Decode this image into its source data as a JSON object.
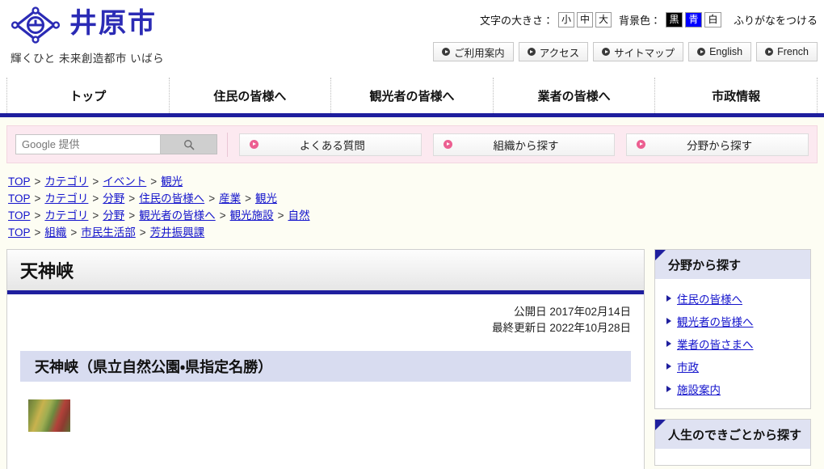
{
  "header": {
    "city_name": "井原市",
    "tagline": "輝くひと 未来創造都市 いばら",
    "emblem_icon": "city-emblem-icon",
    "text_size": {
      "label": "文字の大きさ：",
      "options": [
        "小",
        "中",
        "大"
      ]
    },
    "background_color": {
      "label": "背景色：",
      "options": [
        "黒",
        "青",
        "白"
      ]
    },
    "furigana_label": "ふりがなをつける",
    "links": [
      {
        "label": "ご利用案内",
        "icon": "play-circle-icon"
      },
      {
        "label": "アクセス",
        "icon": "play-circle-icon"
      },
      {
        "label": "サイトマップ",
        "icon": "play-circle-icon"
      },
      {
        "label": "English",
        "icon": "play-circle-icon"
      },
      {
        "label": "French",
        "icon": "play-circle-icon"
      }
    ]
  },
  "global_nav": {
    "items": [
      {
        "label": "トップ"
      },
      {
        "label": "住民の皆様へ"
      },
      {
        "label": "観光者の皆様へ"
      },
      {
        "label": "業者の皆様へ"
      },
      {
        "label": "市政情報"
      }
    ]
  },
  "quickbar": {
    "search": {
      "placeholder": "Google 提供",
      "value": "",
      "button_icon": "magnifier-icon"
    },
    "links": [
      {
        "label": "よくある質問",
        "icon": "pink-play-icon"
      },
      {
        "label": "組織から探す",
        "icon": "pink-play-icon"
      },
      {
        "label": "分野から探す",
        "icon": "pink-play-icon"
      }
    ]
  },
  "breadcrumbs": [
    {
      "items": [
        "TOP",
        "カテゴリ",
        "イベント",
        "観光"
      ]
    },
    {
      "items": [
        "TOP",
        "カテゴリ",
        "分野",
        "住民の皆様へ",
        "産業",
        "観光"
      ]
    },
    {
      "items": [
        "TOP",
        "カテゴリ",
        "分野",
        "観光者の皆様へ",
        "観光施設",
        "自然"
      ]
    },
    {
      "items": [
        "TOP",
        "組織",
        "市民生活部",
        "芳井振興課"
      ]
    }
  ],
  "article": {
    "title": "天神峡",
    "published_label": "公開日 2017年02月14日",
    "updated_label": "最終更新日 2022年10月28日",
    "subheading": "天神峡（県立自然公園・県指定名勝）",
    "photo_alt": "天神峡の紅葉写真"
  },
  "sidebar": {
    "boxes": [
      {
        "title": "分野から探す",
        "items": [
          {
            "label": "住民の皆様へ"
          },
          {
            "label": "観光者の皆様へ"
          },
          {
            "label": "業者の皆さまへ"
          },
          {
            "label": "市政"
          },
          {
            "label": "施設案内"
          }
        ]
      },
      {
        "title": "人生のできごとから探す",
        "items": []
      }
    ]
  },
  "colors": {
    "brand_navy": "#1f1f9e",
    "brand_blue": "#2b2bb5",
    "link_blue": "#1414cc",
    "quickbar_pink": "#fce9f0",
    "pink_accent": "#ec5f91",
    "subhead_lavender": "#d8dcf0",
    "page_bg": "#fdfdf3"
  }
}
